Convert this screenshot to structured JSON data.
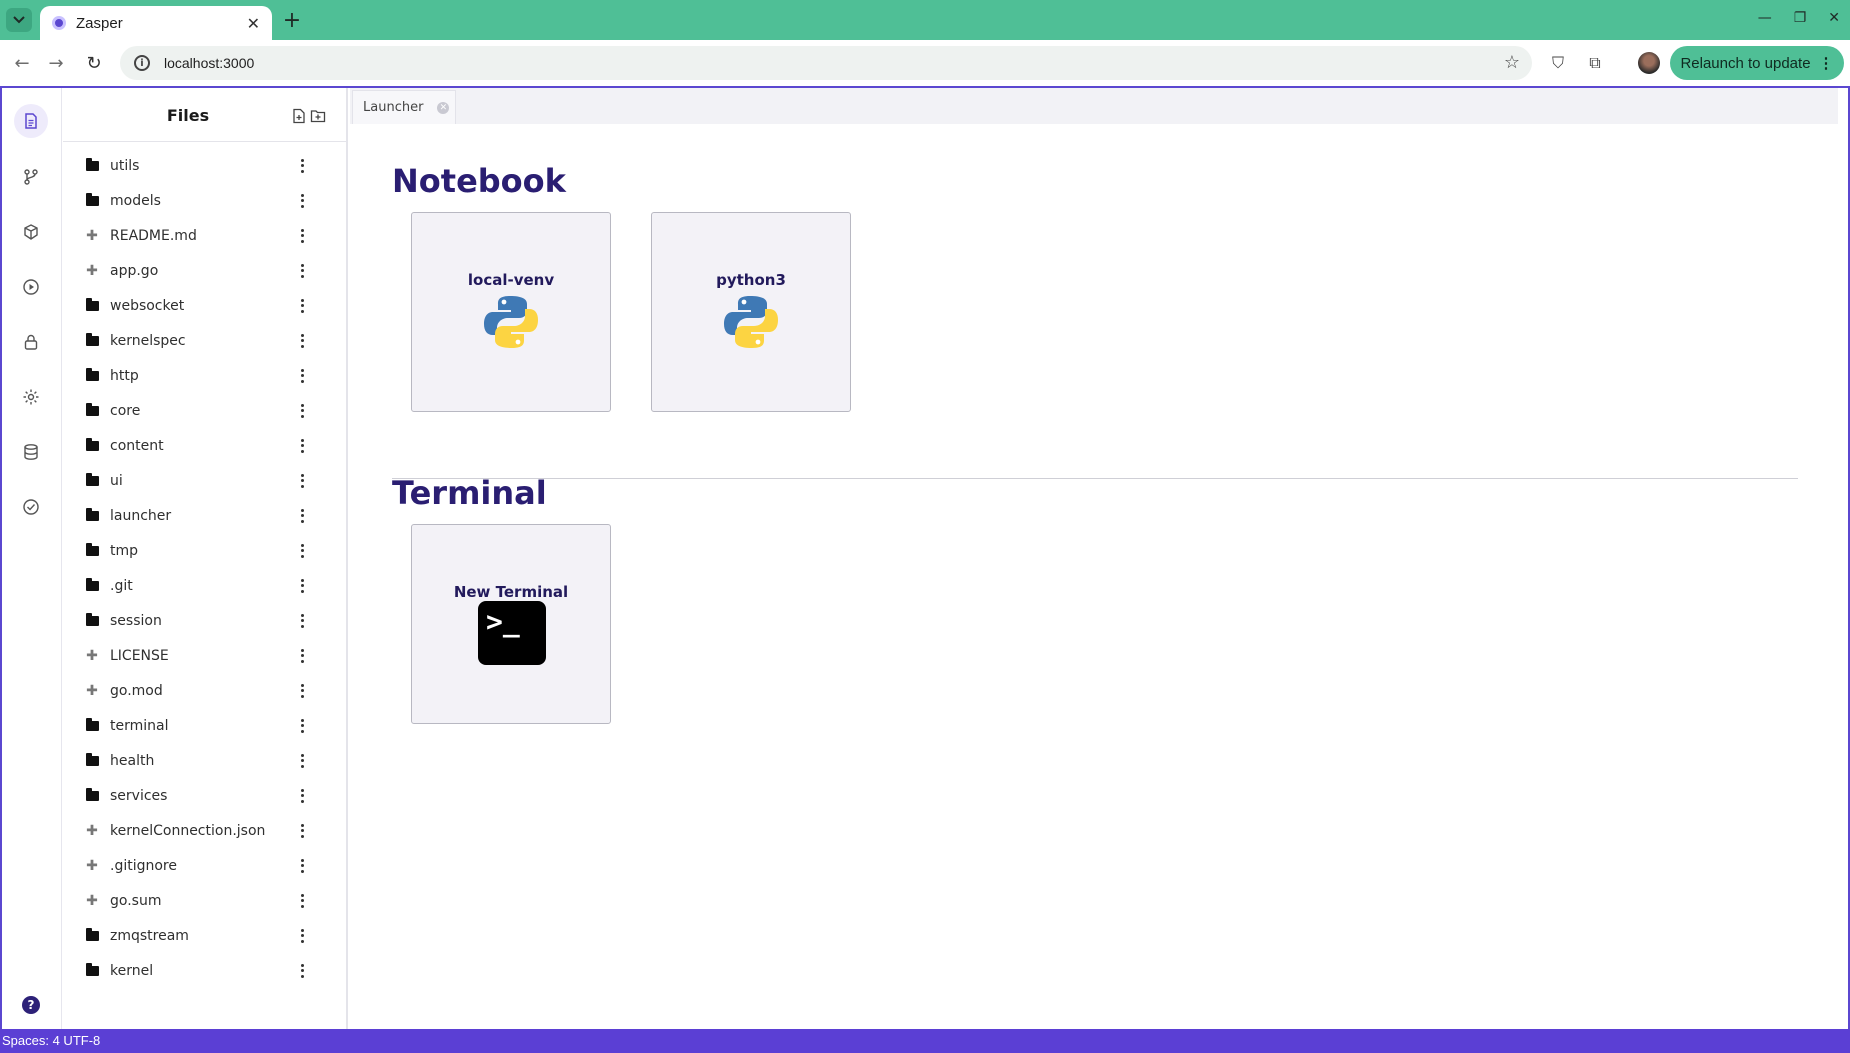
{
  "browser": {
    "tab_title": "Zasper",
    "url": "localhost:3000",
    "relaunch_label": "Relaunch to update"
  },
  "activity_bar": {
    "items": [
      "files-icon",
      "git-branch-icon",
      "package-icon",
      "play-icon",
      "lock-icon",
      "gear-icon",
      "database-icon",
      "check-circle-icon"
    ],
    "help": "?"
  },
  "files": {
    "title": "Files",
    "items": [
      {
        "name": "utils",
        "type": "folder"
      },
      {
        "name": "models",
        "type": "folder"
      },
      {
        "name": "README.md",
        "type": "file"
      },
      {
        "name": "app.go",
        "type": "file"
      },
      {
        "name": "websocket",
        "type": "folder"
      },
      {
        "name": "kernelspec",
        "type": "folder"
      },
      {
        "name": "http",
        "type": "folder"
      },
      {
        "name": "core",
        "type": "folder"
      },
      {
        "name": "content",
        "type": "folder"
      },
      {
        "name": "ui",
        "type": "folder"
      },
      {
        "name": "launcher",
        "type": "folder"
      },
      {
        "name": "tmp",
        "type": "folder"
      },
      {
        "name": ".git",
        "type": "folder"
      },
      {
        "name": "session",
        "type": "folder"
      },
      {
        "name": "LICENSE",
        "type": "file"
      },
      {
        "name": "go.mod",
        "type": "file"
      },
      {
        "name": "terminal",
        "type": "folder"
      },
      {
        "name": "health",
        "type": "folder"
      },
      {
        "name": "services",
        "type": "folder"
      },
      {
        "name": "kernelConnection.json",
        "type": "file"
      },
      {
        "name": ".gitignore",
        "type": "file"
      },
      {
        "name": "go.sum",
        "type": "file"
      },
      {
        "name": "zmqstream",
        "type": "folder"
      },
      {
        "name": "kernel",
        "type": "folder"
      }
    ]
  },
  "editor": {
    "tab_label": "Launcher"
  },
  "launcher": {
    "notebook_title": "Notebook",
    "notebook_kernels": [
      "local-venv",
      "python3"
    ],
    "terminal_title": "Terminal",
    "terminal_label": "New Terminal"
  },
  "status_bar": {
    "text": "Spaces: 4 UTF-8"
  },
  "colors": {
    "browser_accent": "#4fbf96",
    "app_accent": "#5b3fd4",
    "heading": "#2a1e72"
  }
}
